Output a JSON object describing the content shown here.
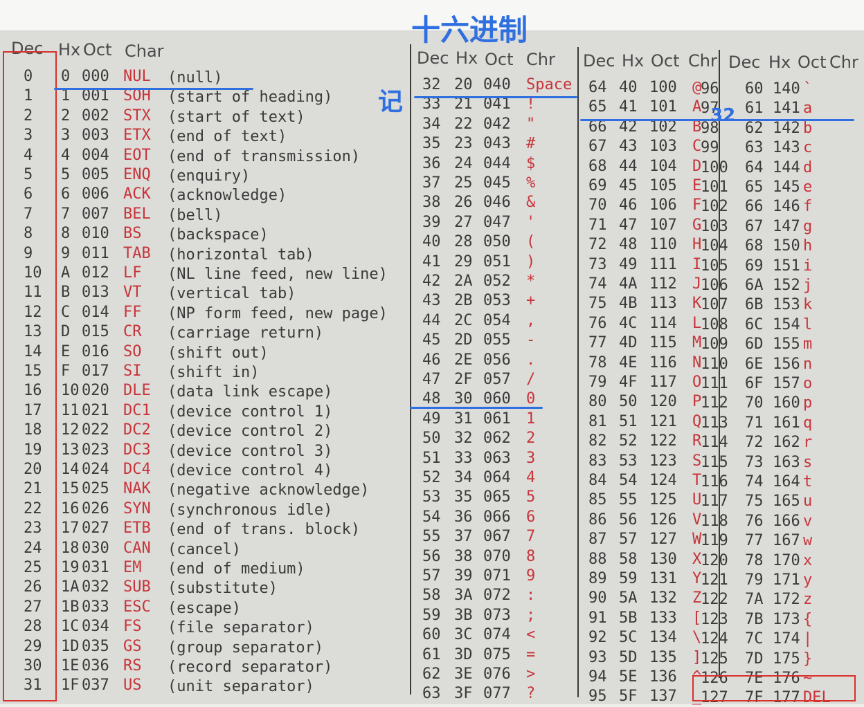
{
  "headers": {
    "g1": [
      "Dec",
      "Hx",
      "Oct",
      "Char"
    ],
    "g2": [
      "Dec",
      "Hx",
      "Oct",
      "Chr"
    ],
    "g3": [
      "Dec",
      "Hx",
      "Oct",
      "Chr"
    ],
    "g4": [
      "Dec",
      "Hx",
      "Oct",
      "Chr"
    ]
  },
  "annotations": {
    "top": "十六进制",
    "left": "记",
    "mid": "32"
  },
  "table": {
    "g1": [
      [
        "0",
        "0",
        "000",
        "NUL",
        "(null)"
      ],
      [
        "1",
        "1",
        "001",
        "SOH",
        "(start of heading)"
      ],
      [
        "2",
        "2",
        "002",
        "STX",
        "(start of text)"
      ],
      [
        "3",
        "3",
        "003",
        "ETX",
        "(end of text)"
      ],
      [
        "4",
        "4",
        "004",
        "EOT",
        "(end of transmission)"
      ],
      [
        "5",
        "5",
        "005",
        "ENQ",
        "(enquiry)"
      ],
      [
        "6",
        "6",
        "006",
        "ACK",
        "(acknowledge)"
      ],
      [
        "7",
        "7",
        "007",
        "BEL",
        "(bell)"
      ],
      [
        "8",
        "8",
        "010",
        "BS",
        "(backspace)"
      ],
      [
        "9",
        "9",
        "011",
        "TAB",
        "(horizontal tab)"
      ],
      [
        "10",
        "A",
        "012",
        "LF",
        "(NL line feed, new line)"
      ],
      [
        "11",
        "B",
        "013",
        "VT",
        "(vertical tab)"
      ],
      [
        "12",
        "C",
        "014",
        "FF",
        "(NP form feed, new page)"
      ],
      [
        "13",
        "D",
        "015",
        "CR",
        "(carriage return)"
      ],
      [
        "14",
        "E",
        "016",
        "SO",
        "(shift out)"
      ],
      [
        "15",
        "F",
        "017",
        "SI",
        "(shift in)"
      ],
      [
        "16",
        "10",
        "020",
        "DLE",
        "(data link escape)"
      ],
      [
        "17",
        "11",
        "021",
        "DC1",
        "(device control 1)"
      ],
      [
        "18",
        "12",
        "022",
        "DC2",
        "(device control 2)"
      ],
      [
        "19",
        "13",
        "023",
        "DC3",
        "(device control 3)"
      ],
      [
        "20",
        "14",
        "024",
        "DC4",
        "(device control 4)"
      ],
      [
        "21",
        "15",
        "025",
        "NAK",
        "(negative acknowledge)"
      ],
      [
        "22",
        "16",
        "026",
        "SYN",
        "(synchronous idle)"
      ],
      [
        "23",
        "17",
        "027",
        "ETB",
        "(end of trans. block)"
      ],
      [
        "24",
        "18",
        "030",
        "CAN",
        "(cancel)"
      ],
      [
        "25",
        "19",
        "031",
        "EM",
        "(end of medium)"
      ],
      [
        "26",
        "1A",
        "032",
        "SUB",
        "(substitute)"
      ],
      [
        "27",
        "1B",
        "033",
        "ESC",
        "(escape)"
      ],
      [
        "28",
        "1C",
        "034",
        "FS",
        "(file separator)"
      ],
      [
        "29",
        "1D",
        "035",
        "GS",
        "(group separator)"
      ],
      [
        "30",
        "1E",
        "036",
        "RS",
        "(record separator)"
      ],
      [
        "31",
        "1F",
        "037",
        "US",
        "(unit separator)"
      ]
    ],
    "g2": [
      [
        "32",
        "20",
        "040",
        "Space"
      ],
      [
        "33",
        "21",
        "041",
        "!"
      ],
      [
        "34",
        "22",
        "042",
        "\""
      ],
      [
        "35",
        "23",
        "043",
        "#"
      ],
      [
        "36",
        "24",
        "044",
        "$"
      ],
      [
        "37",
        "25",
        "045",
        "%"
      ],
      [
        "38",
        "26",
        "046",
        "&"
      ],
      [
        "39",
        "27",
        "047",
        "'"
      ],
      [
        "40",
        "28",
        "050",
        "("
      ],
      [
        "41",
        "29",
        "051",
        ")"
      ],
      [
        "42",
        "2A",
        "052",
        "*"
      ],
      [
        "43",
        "2B",
        "053",
        "+"
      ],
      [
        "44",
        "2C",
        "054",
        ","
      ],
      [
        "45",
        "2D",
        "055",
        "-"
      ],
      [
        "46",
        "2E",
        "056",
        "."
      ],
      [
        "47",
        "2F",
        "057",
        "/"
      ],
      [
        "48",
        "30",
        "060",
        "0"
      ],
      [
        "49",
        "31",
        "061",
        "1"
      ],
      [
        "50",
        "32",
        "062",
        "2"
      ],
      [
        "51",
        "33",
        "063",
        "3"
      ],
      [
        "52",
        "34",
        "064",
        "4"
      ],
      [
        "53",
        "35",
        "065",
        "5"
      ],
      [
        "54",
        "36",
        "066",
        "6"
      ],
      [
        "55",
        "37",
        "067",
        "7"
      ],
      [
        "56",
        "38",
        "070",
        "8"
      ],
      [
        "57",
        "39",
        "071",
        "9"
      ],
      [
        "58",
        "3A",
        "072",
        ":"
      ],
      [
        "59",
        "3B",
        "073",
        ";"
      ],
      [
        "60",
        "3C",
        "074",
        "<"
      ],
      [
        "61",
        "3D",
        "075",
        "="
      ],
      [
        "62",
        "3E",
        "076",
        ">"
      ],
      [
        "63",
        "3F",
        "077",
        "?"
      ]
    ],
    "g3": [
      [
        "64",
        "40",
        "100",
        "@"
      ],
      [
        "65",
        "41",
        "101",
        "A"
      ],
      [
        "66",
        "42",
        "102",
        "B"
      ],
      [
        "67",
        "43",
        "103",
        "C"
      ],
      [
        "68",
        "44",
        "104",
        "D"
      ],
      [
        "69",
        "45",
        "105",
        "E"
      ],
      [
        "70",
        "46",
        "106",
        "F"
      ],
      [
        "71",
        "47",
        "107",
        "G"
      ],
      [
        "72",
        "48",
        "110",
        "H"
      ],
      [
        "73",
        "49",
        "111",
        "I"
      ],
      [
        "74",
        "4A",
        "112",
        "J"
      ],
      [
        "75",
        "4B",
        "113",
        "K"
      ],
      [
        "76",
        "4C",
        "114",
        "L"
      ],
      [
        "77",
        "4D",
        "115",
        "M"
      ],
      [
        "78",
        "4E",
        "116",
        "N"
      ],
      [
        "79",
        "4F",
        "117",
        "O"
      ],
      [
        "80",
        "50",
        "120",
        "P"
      ],
      [
        "81",
        "51",
        "121",
        "Q"
      ],
      [
        "82",
        "52",
        "122",
        "R"
      ],
      [
        "83",
        "53",
        "123",
        "S"
      ],
      [
        "84",
        "54",
        "124",
        "T"
      ],
      [
        "85",
        "55",
        "125",
        "U"
      ],
      [
        "86",
        "56",
        "126",
        "V"
      ],
      [
        "87",
        "57",
        "127",
        "W"
      ],
      [
        "88",
        "58",
        "130",
        "X"
      ],
      [
        "89",
        "59",
        "131",
        "Y"
      ],
      [
        "90",
        "5A",
        "132",
        "Z"
      ],
      [
        "91",
        "5B",
        "133",
        "["
      ],
      [
        "92",
        "5C",
        "134",
        "\\"
      ],
      [
        "93",
        "5D",
        "135",
        "]"
      ],
      [
        "94",
        "5E",
        "136",
        "^"
      ],
      [
        "95",
        "5F",
        "137",
        "_"
      ]
    ],
    "g4": [
      [
        "96",
        "60",
        "140",
        "`"
      ],
      [
        "97",
        "61",
        "141",
        "a"
      ],
      [
        "98",
        "62",
        "142",
        "b"
      ],
      [
        "99",
        "63",
        "143",
        "c"
      ],
      [
        "100",
        "64",
        "144",
        "d"
      ],
      [
        "101",
        "65",
        "145",
        "e"
      ],
      [
        "102",
        "66",
        "146",
        "f"
      ],
      [
        "103",
        "67",
        "147",
        "g"
      ],
      [
        "104",
        "68",
        "150",
        "h"
      ],
      [
        "105",
        "69",
        "151",
        "i"
      ],
      [
        "106",
        "6A",
        "152",
        "j"
      ],
      [
        "107",
        "6B",
        "153",
        "k"
      ],
      [
        "108",
        "6C",
        "154",
        "l"
      ],
      [
        "109",
        "6D",
        "155",
        "m"
      ],
      [
        "110",
        "6E",
        "156",
        "n"
      ],
      [
        "111",
        "6F",
        "157",
        "o"
      ],
      [
        "112",
        "70",
        "160",
        "p"
      ],
      [
        "113",
        "71",
        "161",
        "q"
      ],
      [
        "114",
        "72",
        "162",
        "r"
      ],
      [
        "115",
        "73",
        "163",
        "s"
      ],
      [
        "116",
        "74",
        "164",
        "t"
      ],
      [
        "117",
        "75",
        "165",
        "u"
      ],
      [
        "118",
        "76",
        "166",
        "v"
      ],
      [
        "119",
        "77",
        "167",
        "w"
      ],
      [
        "120",
        "78",
        "170",
        "x"
      ],
      [
        "121",
        "79",
        "171",
        "y"
      ],
      [
        "122",
        "7A",
        "172",
        "z"
      ],
      [
        "123",
        "7B",
        "173",
        "{"
      ],
      [
        "124",
        "7C",
        "174",
        "|"
      ],
      [
        "125",
        "7D",
        "175",
        "}"
      ],
      [
        "126",
        "7E",
        "176",
        "~"
      ],
      [
        "127",
        "7F",
        "177",
        "DEL"
      ]
    ]
  }
}
